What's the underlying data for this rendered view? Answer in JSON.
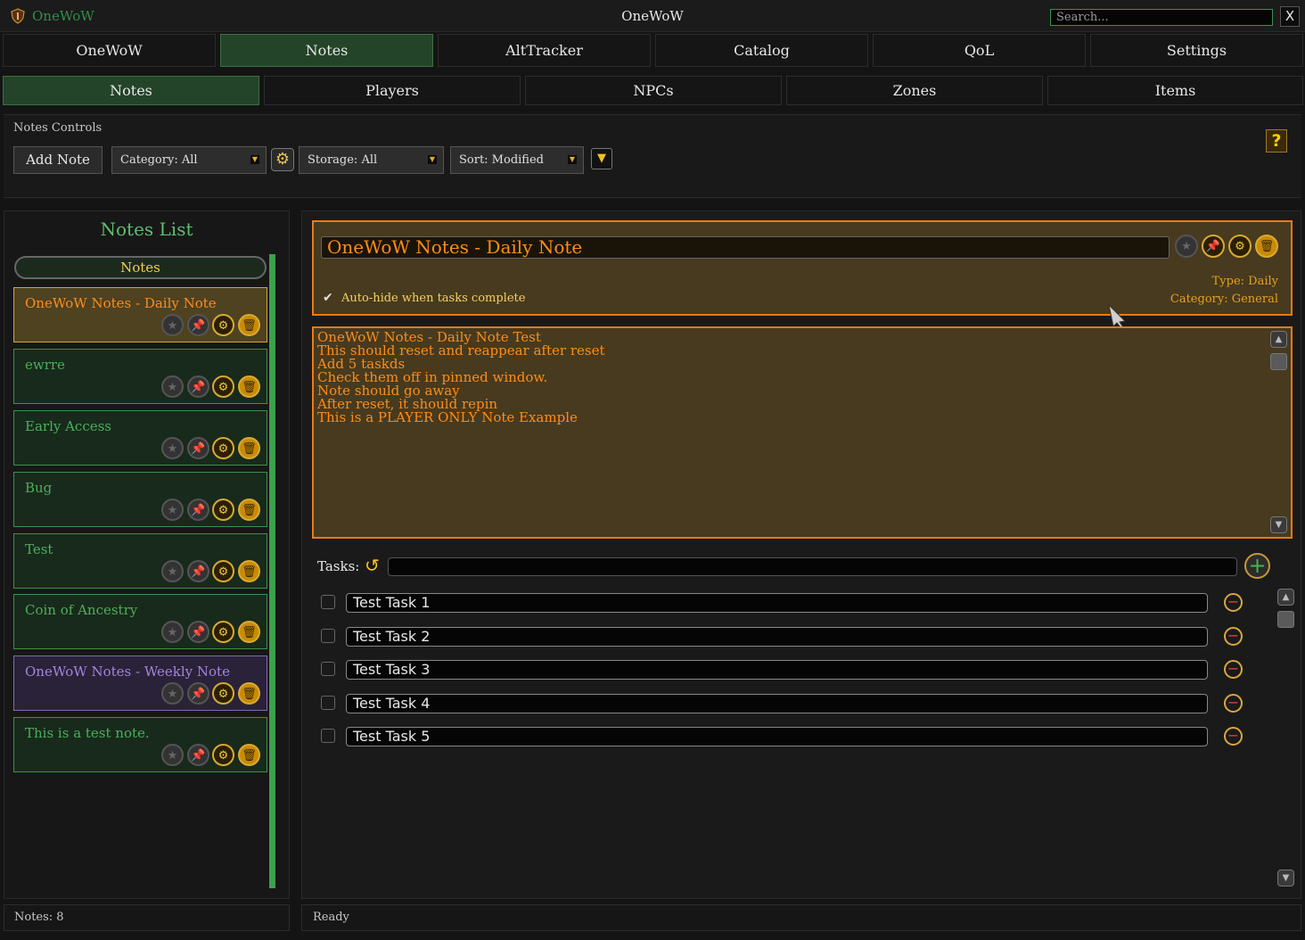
{
  "window": {
    "app_name": "OneWoW",
    "title": "OneWoW",
    "search_placeholder": "Search...",
    "close_label": "X"
  },
  "main_tabs": [
    "OneWoW",
    "Notes",
    "AltTracker",
    "Catalog",
    "QoL",
    "Settings"
  ],
  "active_main_tab": "Notes",
  "sub_tabs": [
    "Notes",
    "Players",
    "NPCs",
    "Zones",
    "Items"
  ],
  "active_sub_tab": "Notes",
  "controls": {
    "label": "Notes Controls",
    "add_note": "Add Note",
    "category": "Category: All",
    "storage": "Storage: All",
    "sort": "Sort: Modified"
  },
  "notes_list": {
    "title": "Notes List",
    "header": "Notes",
    "items": [
      {
        "title": "OneWoW Notes - Daily Note"
      },
      {
        "title": "ewrre"
      },
      {
        "title": "Early Access"
      },
      {
        "title": "Bug"
      },
      {
        "title": "Test"
      },
      {
        "title": "Coin of Ancestry"
      },
      {
        "title": "OneWoW Notes - Weekly Note"
      },
      {
        "title": "This is a test note."
      }
    ]
  },
  "note": {
    "title": "OneWoW Notes - Daily Note",
    "autohide_label": "Auto-hide when tasks complete",
    "autohide_checked": true,
    "type": "Type: Daily",
    "category": "Category: General",
    "body_lines": [
      "OneWoW Notes - Daily Note Test",
      "This should reset and reappear after reset",
      "Add 5 taskds",
      "Check them off in pinned window.",
      "Note should go away",
      "After reset, it should repin",
      "This is a PLAYER ONLY Note Example"
    ]
  },
  "tasks": {
    "label": "Tasks:",
    "items": [
      "Test Task 1",
      "Test Task 2",
      "Test Task 3",
      "Test Task 4",
      "Test Task 5"
    ]
  },
  "status": {
    "left": "Notes: 8",
    "right": "Ready"
  },
  "colors": {
    "accent_green": "#3ea04e",
    "accent_orange": "#ef7a15",
    "gold": "#d9aa33"
  }
}
